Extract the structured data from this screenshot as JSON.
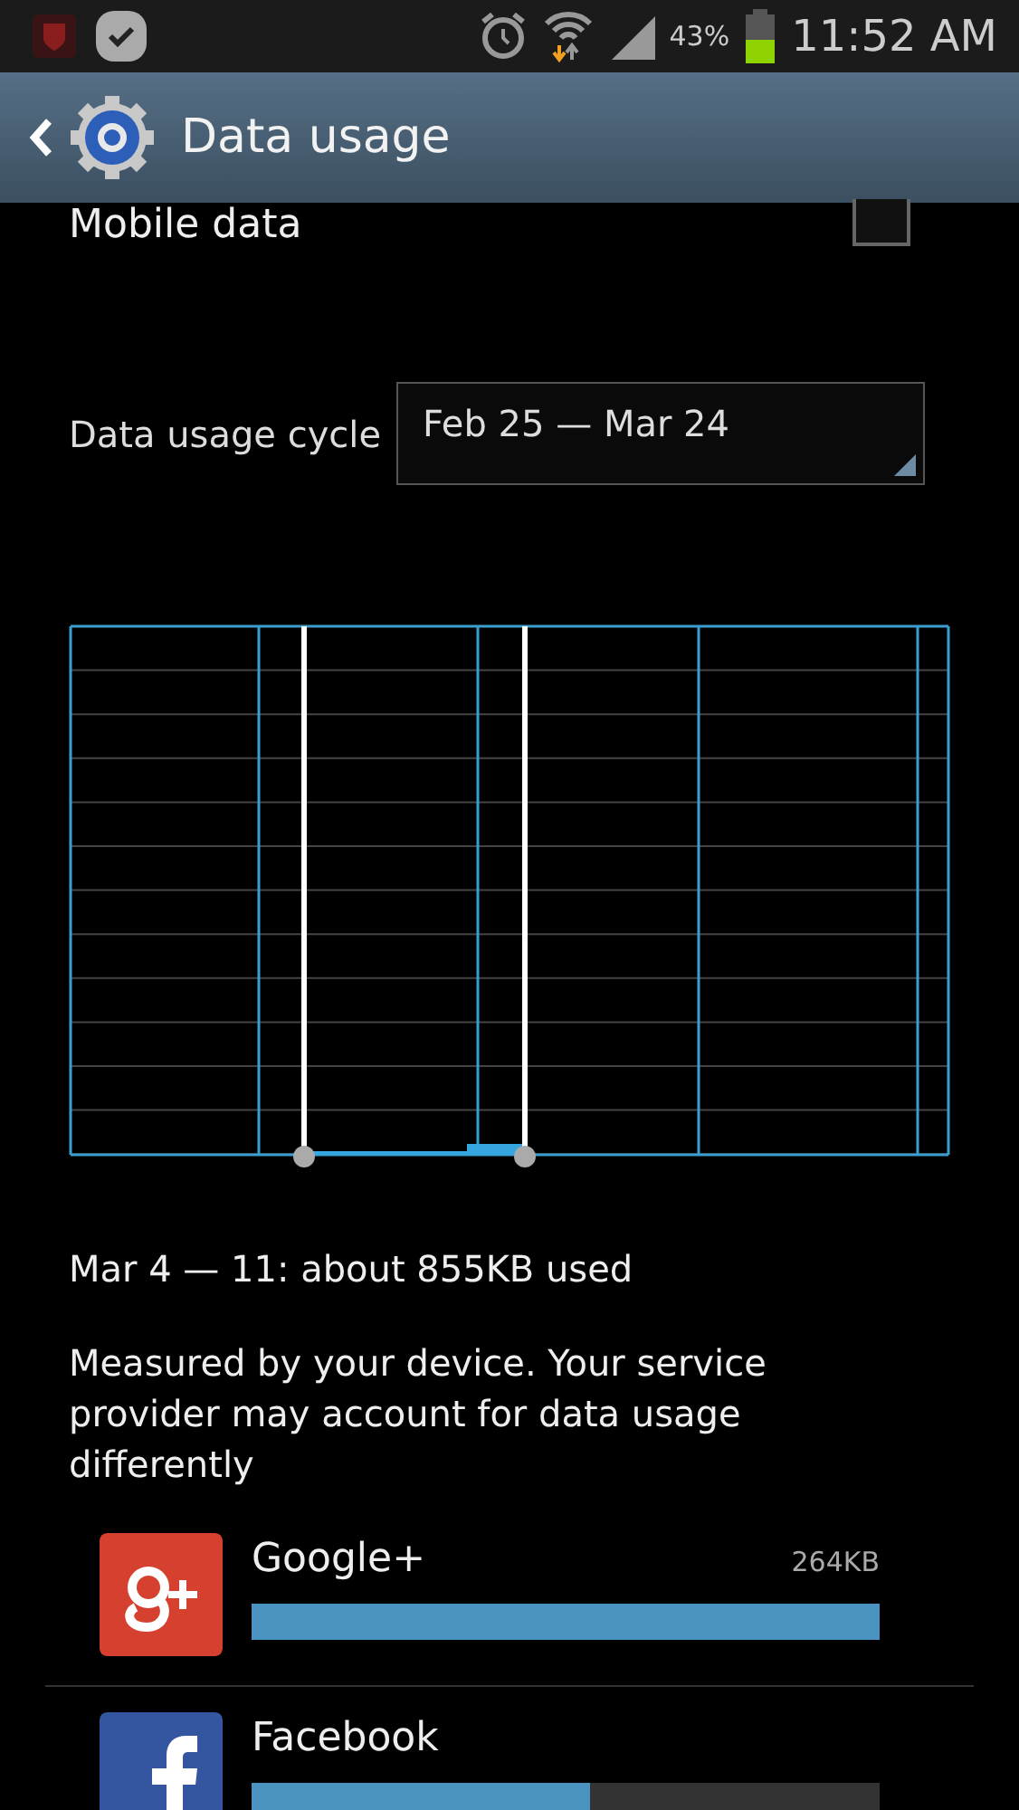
{
  "status_bar": {
    "battery_percent": "43%",
    "time": "11:52 AM"
  },
  "action_bar": {
    "title": "Data usage"
  },
  "mobile_data": {
    "label": "Mobile data",
    "checked": false
  },
  "cycle": {
    "label": "Data usage cycle",
    "value": "Feb 25 — Mar 24"
  },
  "summary": "Mar 4 — 11: about 855KB used",
  "note": "Measured by your device. Your service provider may account for data usage differently",
  "apps": [
    {
      "name": "Google+",
      "usage": "264KB",
      "level": 1.0,
      "kind": "gplus"
    },
    {
      "name": "Facebook",
      "level": 0.54,
      "kind": "facebook"
    }
  ]
}
